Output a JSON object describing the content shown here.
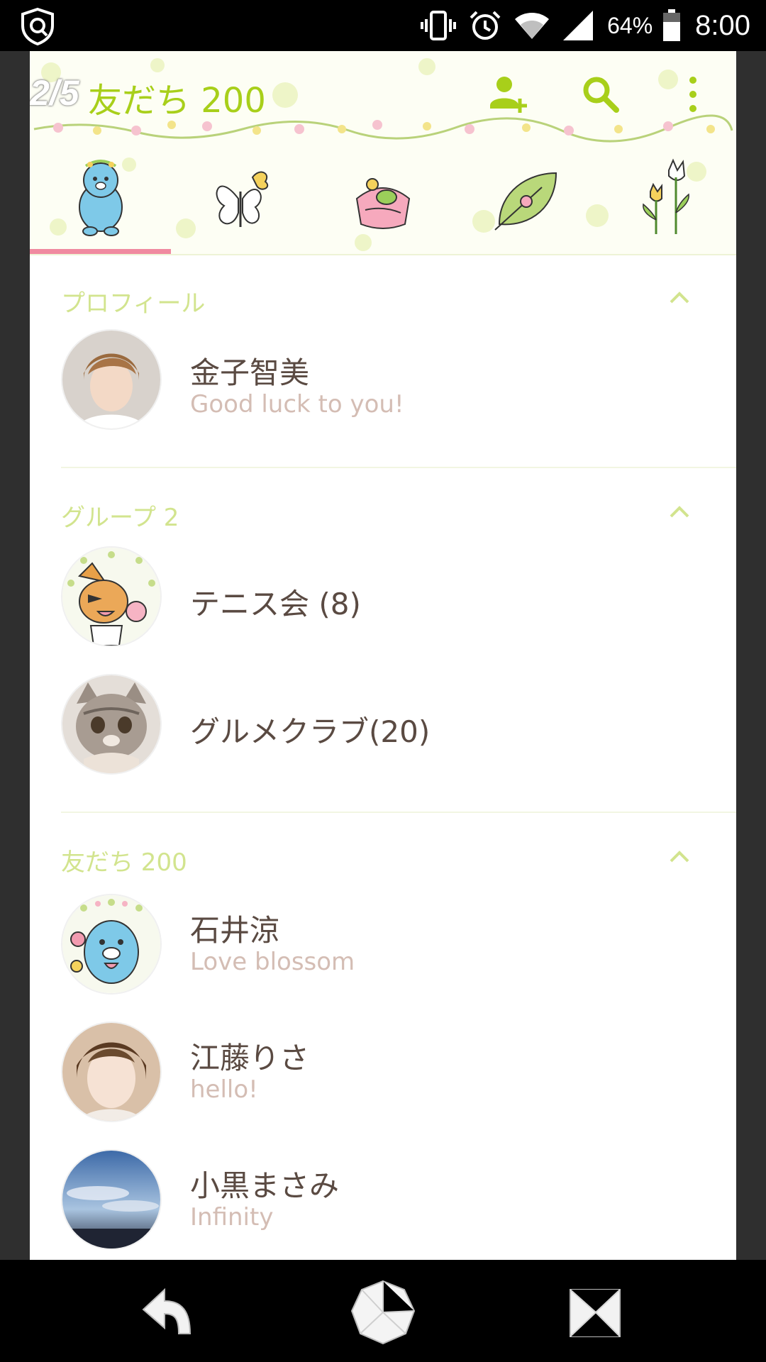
{
  "status_bar": {
    "battery_percent": "64%",
    "time": "8:00",
    "icons": [
      "shield-icon",
      "vibrate-icon",
      "alarm-icon",
      "wifi-icon",
      "signal-icon",
      "battery-icon"
    ]
  },
  "header": {
    "page_indicator": "2/5",
    "title": "友だち 200",
    "actions": [
      "add-friend-icon",
      "search-icon",
      "more-menu-icon"
    ],
    "accent_color": "#a8cf1a",
    "tabs": [
      "friends-tab",
      "butterfly-tab",
      "bag-tab",
      "leaf-tab",
      "tulip-tab"
    ],
    "active_tab": 0
  },
  "profile": {
    "label": "プロフィール",
    "name": "金子智美",
    "status": "Good luck to you!"
  },
  "groups": {
    "label": "グループ 2",
    "items": [
      {
        "name": "テニス会 (8)"
      },
      {
        "name": "グルメクラブ(20)"
      }
    ]
  },
  "friends": {
    "label": "友だち 200",
    "items": [
      {
        "name": "石井涼",
        "status": "Love blossom"
      },
      {
        "name": "江藤りさ",
        "status": "hello!"
      },
      {
        "name": "小黒まさみ",
        "status": "Infinity"
      }
    ]
  },
  "colors": {
    "name_text": "#5a4a42",
    "status_text": "#d4bdb4",
    "section_label": "#d2e48e",
    "tab_underline": "#f08aa0"
  }
}
